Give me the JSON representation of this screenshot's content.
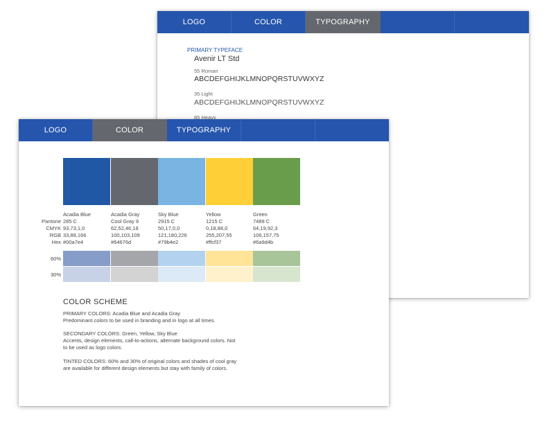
{
  "back_sheet": {
    "tabs": [
      {
        "label": "LOGO",
        "active": false
      },
      {
        "label": "COLOR",
        "active": false
      },
      {
        "label": "TYPOGRAPHY",
        "active": true
      },
      {
        "label": "",
        "active": false
      },
      {
        "label": "",
        "active": false
      }
    ],
    "typography": {
      "section_label": "PRIMARY TYPEFACE",
      "family": "Avenir LT Std",
      "weights": [
        {
          "name": "55 Roman",
          "sample": "ABCDEFGHIJKLMNOPQRSTUVWXYZ"
        },
        {
          "name": "35 Light",
          "sample": "ABCDEFGHIJKLMNOPQRSTUVWXYZ"
        },
        {
          "name": "85 Heavy",
          "sample": ""
        }
      ]
    }
  },
  "front_sheet": {
    "tabs": [
      {
        "label": "LOGO",
        "active": false
      },
      {
        "label": "COLOR",
        "active": true
      },
      {
        "label": "TYPOGRAPHY",
        "active": false
      },
      {
        "label": "",
        "active": false
      },
      {
        "label": "",
        "active": false
      }
    ],
    "row_labels": {
      "pantone": "Pantone",
      "cmyk": "CMYK",
      "rgb": "RGB",
      "hex": "Hex",
      "tint60": "60%",
      "tint30": "30%"
    },
    "colors": [
      {
        "name": "Acadia Blue",
        "pantone": "285 C",
        "cmyk": "93,73,1,0",
        "rgb": "33,88,166",
        "hex": "#00a7e4",
        "swatch": "#2158a6",
        "tint60": "#869cc9",
        "tint30": "#c7d2e6"
      },
      {
        "name": "Acadia Gray",
        "pantone": "Cool Gray 9",
        "cmyk": "62,52,46,18",
        "rgb": "100,103,109",
        "hex": "#64676d",
        "swatch": "#64676d",
        "tint60": "#a5a6a9",
        "tint30": "#d3d3d4"
      },
      {
        "name": "Sky Blue",
        "pantone": "2915 C",
        "cmyk": "50,17,0,0",
        "rgb": "121,180,226",
        "hex": "#79b4e2",
        "swatch": "#79b4e2",
        "tint60": "#b2d2ef",
        "tint30": "#dceaf7"
      },
      {
        "name": "Yellow",
        "pantone": "1215 C",
        "cmyk": "0,18,88,0",
        "rgb": "255,207,55",
        "hex": "#ffcf37",
        "swatch": "#ffcf37",
        "tint60": "#ffe397",
        "tint30": "#fff1cc"
      },
      {
        "name": "Green",
        "pantone": "7489 C",
        "cmyk": "64,19,92,3",
        "rgb": "106,157,75",
        "hex": "#6a9d4b",
        "swatch": "#6a9d4b",
        "tint60": "#a8c59a",
        "tint30": "#d7e5cf"
      }
    ],
    "scheme": {
      "title": "COLOR SCHEME",
      "primary_lines": [
        "PRIMARY COLORS: Acadia Blue and Acadia Gray",
        "Predominant colors to be used in branding and in logo at all times."
      ],
      "secondary_lines": [
        "SECONDARY COLORS: Green, Yellow, Sky Blue",
        "Accents, design elements, call-to-actions, alternate background colors. Not",
        "to be used as logo colors."
      ],
      "tinted_lines": [
        "TINTED COLORS: 60% and 30% of original colors and shades of cool gray",
        "are available for different design elements but stay with family of colors."
      ]
    }
  },
  "theme": {
    "nav_blue": "#2655ad",
    "nav_active_gray": "#64676d",
    "accent_text_blue": "#2556b0"
  }
}
